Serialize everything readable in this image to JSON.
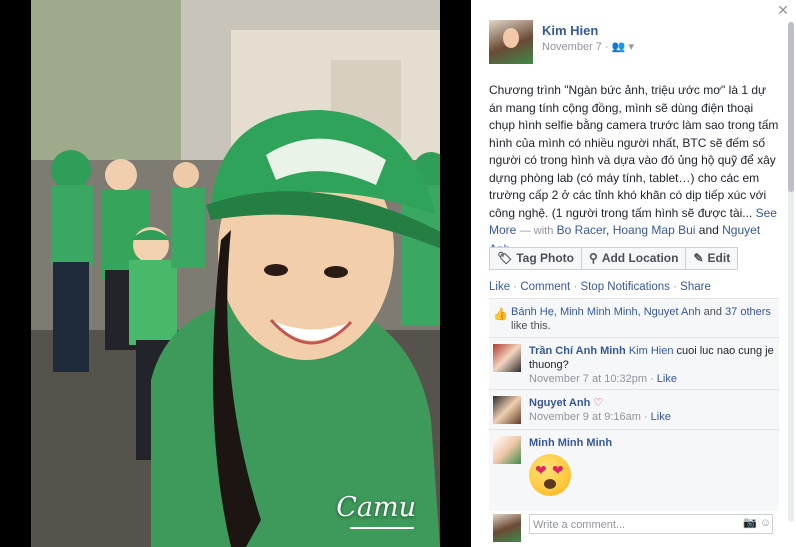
{
  "photo": {
    "watermark": "Camu"
  },
  "post": {
    "author": "Kim Hien",
    "date": "November 7",
    "text": "Chương trình \"Ngàn bức ảnh, triệu ước mơ\" là 1 dự án mang tính cộng đồng, mình sẽ dùng điện thoại chụp hình selfie bằng camera trước làm sao trong tấm hình của mình có nhiều người nhất, BTC sẽ đếm số người có trong hình và dựa vào đó ủng hộ quỹ để xây dựng phòng lab (có máy tính, tablet…) cho các em trường cấp 2 ở các tỉnh khó khăn có dịp tiếp xúc với công nghệ. (1 người trong tấm hình sẽ được tài...",
    "see_more": "See More",
    "with_prefix": "— with",
    "tagged": [
      "Bo Racer",
      "Hoang Map Bui",
      "Nguyet Anh"
    ],
    "tag_sep": ",",
    "tag_and": "and"
  },
  "actions": {
    "tag_photo": "Tag Photo",
    "add_location": "Add Location",
    "edit": "Edit"
  },
  "ufi": {
    "like": "Like",
    "comment": "Comment",
    "stop_notifications": "Stop Notifications",
    "share": "Share",
    "likers": [
      "Bánh Hẹ",
      "Minh Minh Minh",
      "Nguyet Anh"
    ],
    "likers_and": "and",
    "others": "37 others",
    "likes_suffix": "like this."
  },
  "comments": [
    {
      "name": "Trần Chí Anh Minh",
      "mention": "Kim Hien",
      "text": "cuoi luc nao cung je thuong?",
      "time": "November 7 at 10:32pm",
      "like": "Like"
    },
    {
      "name": "Nguyet Anh",
      "text": "",
      "time": "November 9 at 9:16am",
      "like": "Like"
    },
    {
      "name": "Minh Minh Minh",
      "text": "",
      "time": "",
      "like": ""
    }
  ],
  "composer": {
    "placeholder": "Write a comment..."
  },
  "colors": {
    "link": "#365899",
    "muted": "#90949c",
    "hat": "#2fa35a"
  }
}
